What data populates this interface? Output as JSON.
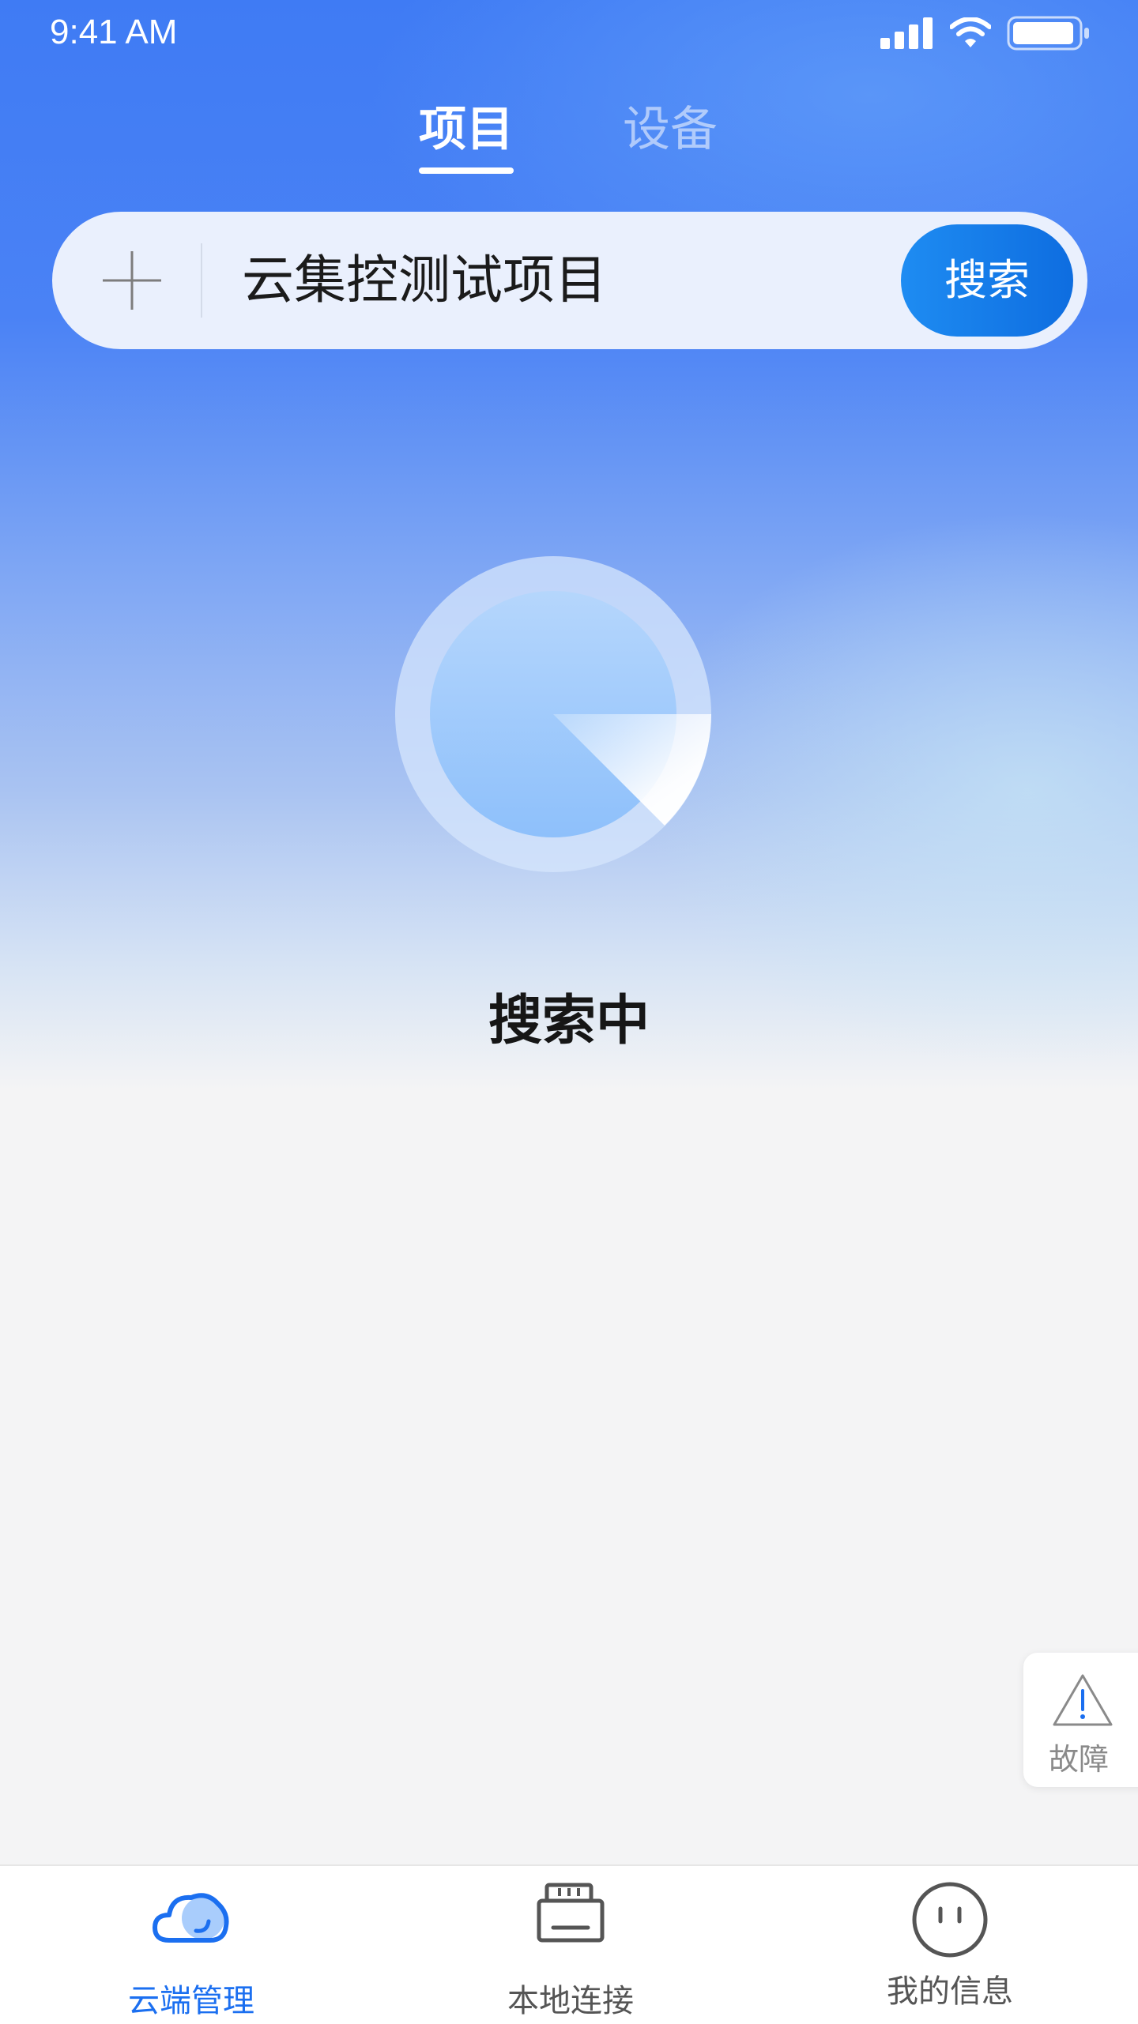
{
  "status_bar": {
    "time": "9:41 AM"
  },
  "tabs": [
    {
      "label": "项目",
      "active": true
    },
    {
      "label": "设备",
      "active": false
    }
  ],
  "search": {
    "value": "云集控测试项目",
    "button_label": "搜索"
  },
  "loading": {
    "text": "搜索中"
  },
  "fault_button": {
    "label": "故障",
    "icon": "warning-icon"
  },
  "bottom_nav": [
    {
      "label": "云端管理",
      "icon": "cloud-icon",
      "active": true
    },
    {
      "label": "本地连接",
      "icon": "router-icon",
      "active": false
    },
    {
      "label": "我的信息",
      "icon": "face-icon",
      "active": false
    }
  ],
  "colors": {
    "accent": "#1b6ff0",
    "header_blue": "#3f7bf4",
    "search_button": "#1e8cf2"
  }
}
